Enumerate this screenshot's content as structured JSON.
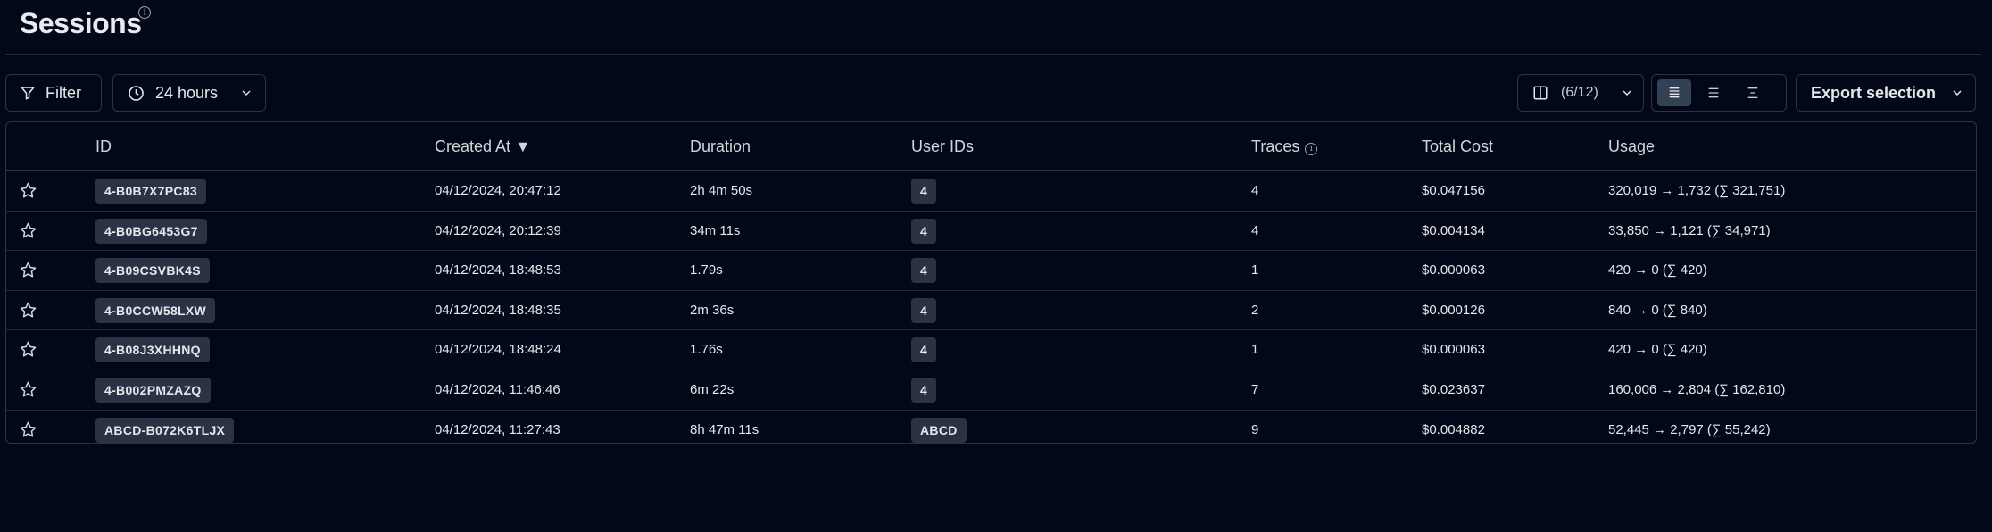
{
  "page": {
    "title": "Sessions"
  },
  "toolbar": {
    "filter_label": "Filter",
    "time_range_label": "24 hours",
    "columns_label": "(6/12)",
    "export_label": "Export selection",
    "density_options": [
      "comfortable",
      "normal",
      "compact"
    ],
    "density_selected": "comfortable"
  },
  "table": {
    "columns": {
      "id": "ID",
      "created_at": "Created At ▼",
      "duration": "Duration",
      "user_ids": "User IDs",
      "traces": "Traces",
      "total_cost": "Total Cost",
      "usage": "Usage"
    },
    "rows": [
      {
        "id": "4-B0B7X7PC83",
        "created_at": "04/12/2024, 20:47:12",
        "duration": "2h 4m 50s",
        "user_ids": "4",
        "traces": "4",
        "total_cost": "$0.047156",
        "usage": "320,019 → 1,732 (∑ 321,751)"
      },
      {
        "id": "4-B0BG6453G7",
        "created_at": "04/12/2024, 20:12:39",
        "duration": "34m 11s",
        "user_ids": "4",
        "traces": "4",
        "total_cost": "$0.004134",
        "usage": "33,850 → 1,121 (∑ 34,971)"
      },
      {
        "id": "4-B09CSVBK4S",
        "created_at": "04/12/2024, 18:48:53",
        "duration": "1.79s",
        "user_ids": "4",
        "traces": "1",
        "total_cost": "$0.000063",
        "usage": "420 → 0 (∑ 420)"
      },
      {
        "id": "4-B0CCW58LXW",
        "created_at": "04/12/2024, 18:48:35",
        "duration": "2m 36s",
        "user_ids": "4",
        "traces": "2",
        "total_cost": "$0.000126",
        "usage": "840 → 0 (∑ 840)"
      },
      {
        "id": "4-B08J3XHHNQ",
        "created_at": "04/12/2024, 18:48:24",
        "duration": "1.76s",
        "user_ids": "4",
        "traces": "1",
        "total_cost": "$0.000063",
        "usage": "420 → 0 (∑ 420)"
      },
      {
        "id": "4-B002PMZAZQ",
        "created_at": "04/12/2024, 11:46:46",
        "duration": "6m 22s",
        "user_ids": "4",
        "traces": "7",
        "total_cost": "$0.023637",
        "usage": "160,006 → 2,804 (∑ 162,810)"
      },
      {
        "id": "ABCD-B072K6TLJX",
        "created_at": "04/12/2024, 11:27:43",
        "duration": "8h 47m 11s",
        "user_ids": "ABCD",
        "traces": "9",
        "total_cost": "$0.004882",
        "usage": "52,445 → 2,797 (∑ 55,242)"
      }
    ]
  },
  "icons": {
    "filter": "filter-icon",
    "clock": "clock-icon",
    "chevron": "chevron-down-icon",
    "columns": "columns-icon",
    "star": "star-icon",
    "info": "info-icon"
  },
  "colors": {
    "background": "#020817",
    "border": "#2a3444",
    "badge": "#2a3244",
    "active_toggle": "#334155"
  }
}
